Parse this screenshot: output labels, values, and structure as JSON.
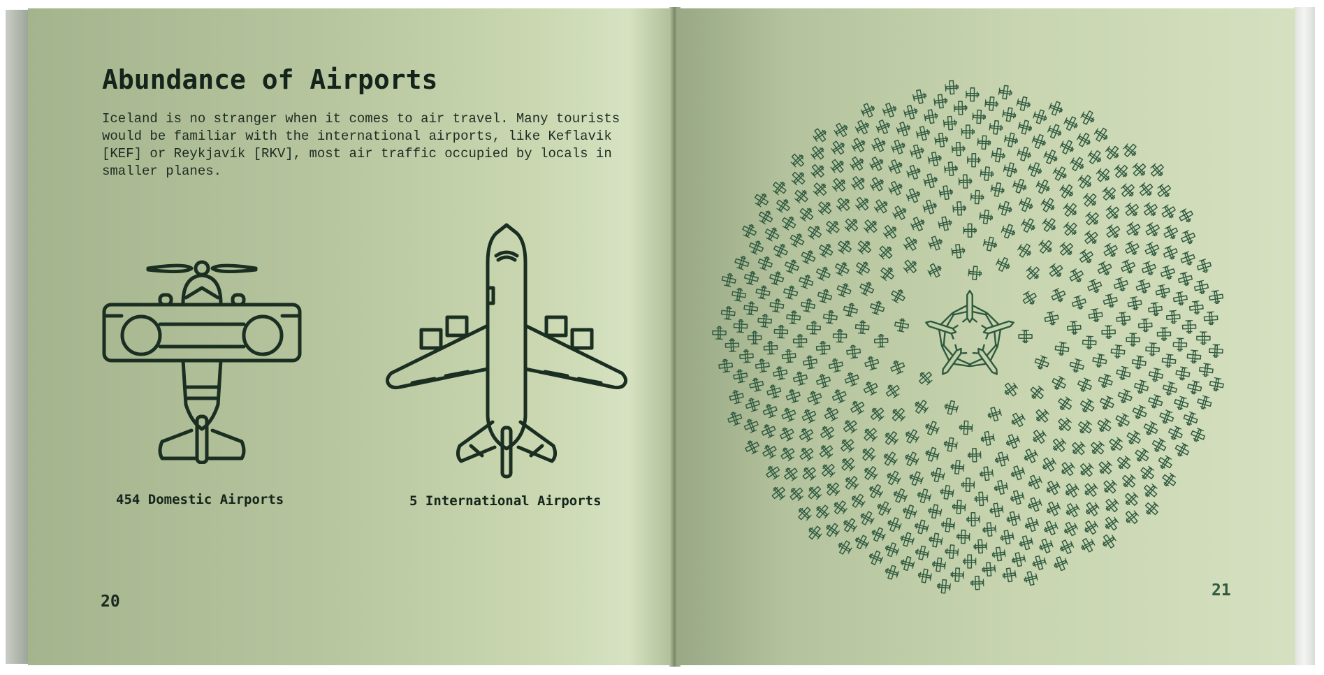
{
  "left_page": {
    "title": "Abundance of Airports",
    "body": "Iceland is no stranger when it comes to air travel. Many tourists would be familiar with the international airports, like Keflavik [KEF] or Reykjavík [RKV], most air traffic occupied by locals in smaller planes.",
    "domestic": {
      "icon": "propeller-plane-icon",
      "caption": "454 Domestic Airports",
      "count": 454
    },
    "international": {
      "icon": "jet-airliner-icon",
      "caption": "5 International Airports",
      "count": 5
    },
    "page_number": "20"
  },
  "right_page": {
    "illustration": "plane-spiral-icon",
    "page_number": "21"
  },
  "colors": {
    "ink": "#14241a",
    "plane_green": "#2f5a40",
    "page_green": "#c8d5b0"
  }
}
